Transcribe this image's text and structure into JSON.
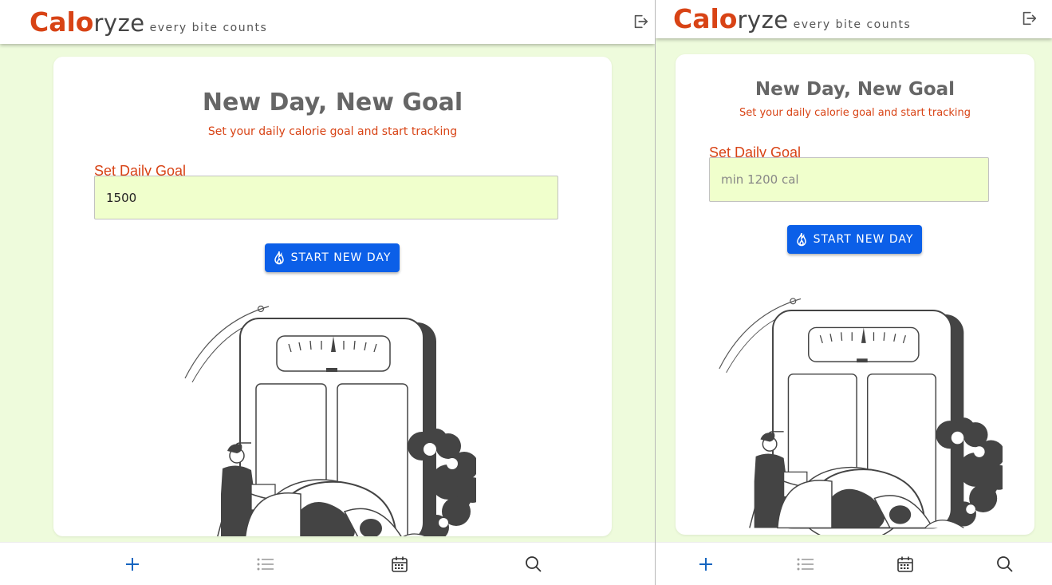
{
  "app": {
    "brand_calo": "Calo",
    "brand_ryze": "ryze",
    "tagline": "every bite counts"
  },
  "left": {
    "heading": "New Day, New Goal",
    "subheading": "Set your daily calorie goal and start tracking",
    "goal_label": "Set Daily Goal",
    "goal_value": "1500",
    "goal_placeholder": "min 1200 cal",
    "start_button": "START NEW DAY"
  },
  "right": {
    "heading": "New Day, New Goal",
    "subheading": "Set your daily calorie goal and start tracking",
    "goal_label": "Set Daily Goal",
    "goal_value": "",
    "goal_placeholder": "min 1200 cal",
    "start_button": "START NEW DAY"
  },
  "nav": {
    "items": [
      "add-icon",
      "list-icon",
      "calendar-icon",
      "search-icon"
    ],
    "active": "add-icon"
  },
  "colors": {
    "brand": "#d84315",
    "accent_button": "#0b5fe8",
    "page_bg": "#eefbdc",
    "input_bg": "#f0ffcc",
    "nav_active": "#1565c0",
    "nav_inactive": "#9e9e9e"
  }
}
